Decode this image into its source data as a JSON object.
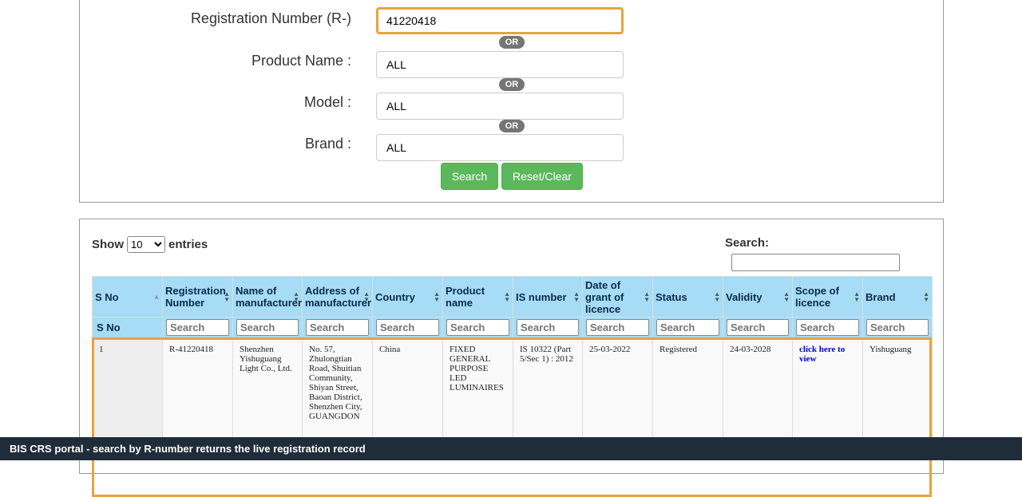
{
  "form": {
    "registration_label": "Registration Number (R-)",
    "registration_value": "41220418",
    "product_label": "Product Name :",
    "product_value": "ALL",
    "model_label": "Model :",
    "model_value": "ALL",
    "brand_label": "Brand :",
    "brand_value": "ALL",
    "or_label": "OR",
    "search_button": "Search",
    "reset_button": "Reset/Clear"
  },
  "table_controls": {
    "show_label": "Show",
    "entries_value": "10",
    "entries_label": "entries",
    "search_label": "Search:"
  },
  "columns": [
    {
      "label": "S No"
    },
    {
      "label": "Registration Number"
    },
    {
      "label": "Name of manufacturer"
    },
    {
      "label": "Address of manufacturer"
    },
    {
      "label": "Country"
    },
    {
      "label": "Product name"
    },
    {
      "label": "IS number"
    },
    {
      "label": "Date of grant of licence"
    },
    {
      "label": "Status"
    },
    {
      "label": "Validity"
    },
    {
      "label": "Scope of licence"
    },
    {
      "label": "Brand"
    }
  ],
  "filter_placeholder": "Search",
  "filter_sno_label": "S No",
  "row": {
    "sno": "1",
    "registration": "R-41220418",
    "manufacturer": "Shenzhen Yishuguang Light Co., Ltd.",
    "address": "No. 57, Zhulongtian Road, Shuitian Community, Shiyan Street, Baoan District, Shenzhen City, GUANGDON",
    "country": "China",
    "product": "FIXED GENERAL PURPOSE LED LUMINAIRES",
    "is_number": "IS 10322 (Part 5/Sec 1) : 2012",
    "grant_date": "25-03-2022",
    "status": "Registered",
    "validity": "24-03-2028",
    "scope": "click here to view",
    "brand": "Yishuguang"
  },
  "caption": "BIS CRS portal - search by R-number returns the live registration record",
  "colors": {
    "header_bg": "#a6dcf5",
    "button_green": "#5cb85c",
    "focus_orange": "#e8a33c",
    "caption_bg": "#1f2d3a"
  }
}
